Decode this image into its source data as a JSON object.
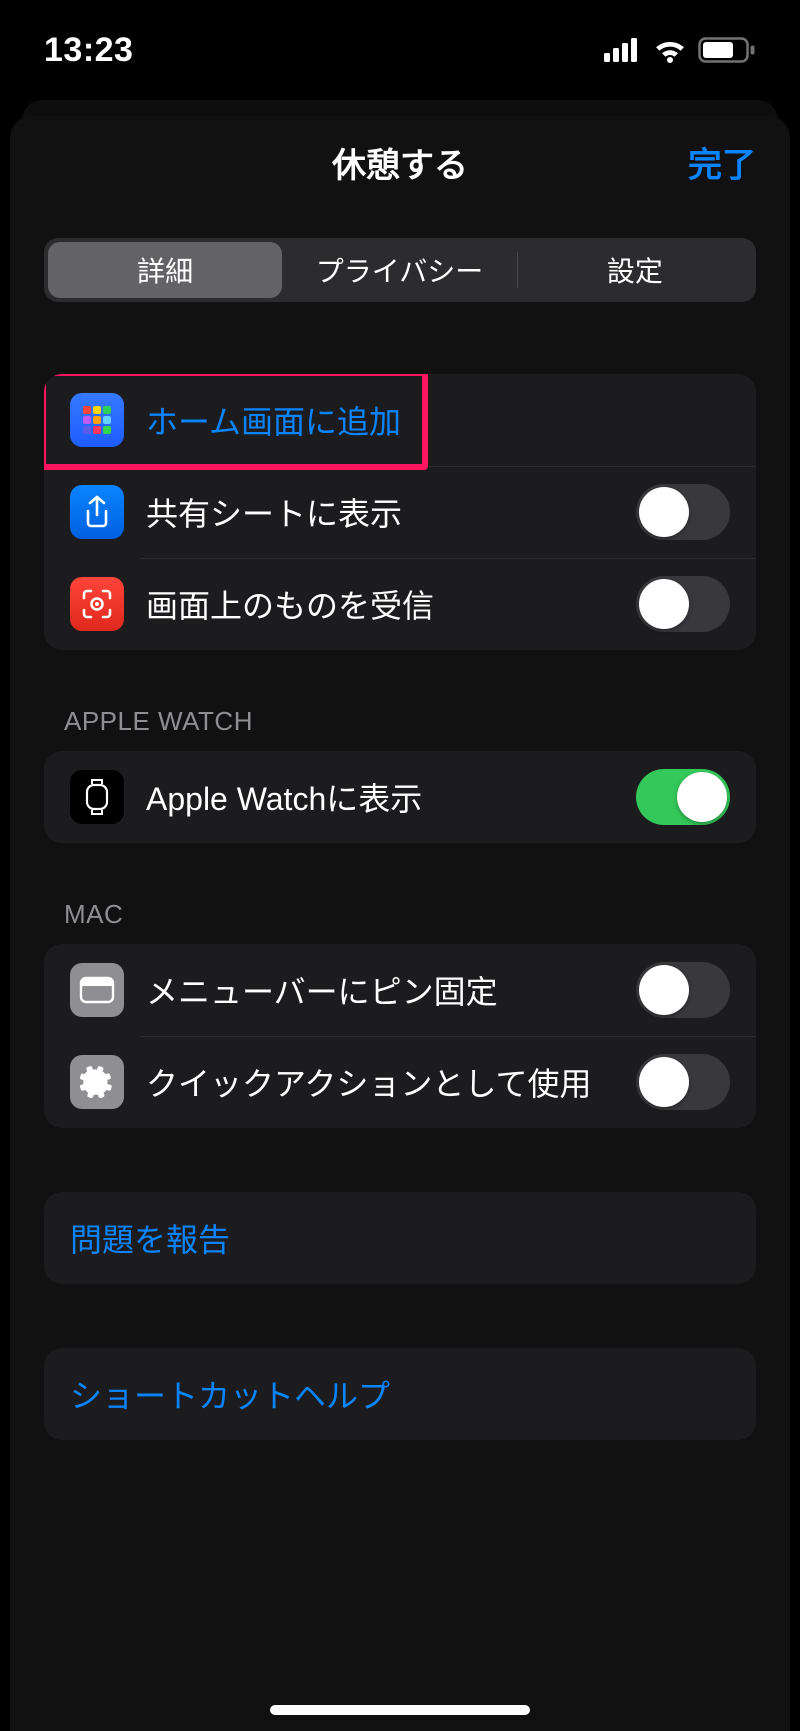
{
  "status": {
    "time": "13:23"
  },
  "sheet": {
    "title": "休憩する",
    "done": "完了",
    "tabs": {
      "details": "詳細",
      "privacy": "プライバシー",
      "settings": "設定",
      "selected": 0
    }
  },
  "group1": {
    "add_to_home": "ホーム画面に追加",
    "share_sheet": "共有シートに表示",
    "receive_onscreen": "画面上のものを受信",
    "share_sheet_on": false,
    "receive_onscreen_on": false
  },
  "apple_watch": {
    "header": "APPLE WATCH",
    "show": "Apple Watchに表示",
    "show_on": true
  },
  "mac": {
    "header": "MAC",
    "pin_menubar": "メニューバーにピン固定",
    "quick_action": "クイックアクションとして使用",
    "pin_menubar_on": false,
    "quick_action_on": false
  },
  "footer": {
    "report": "問題を報告",
    "help": "ショートカットヘルプ"
  }
}
